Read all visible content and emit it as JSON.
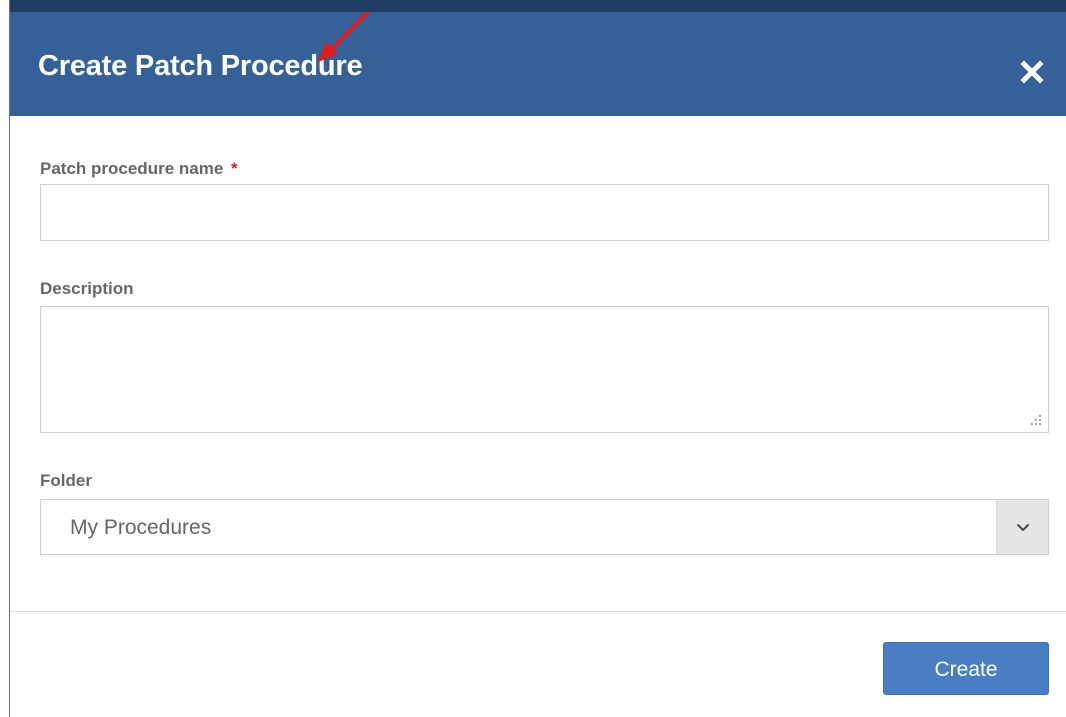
{
  "dialog": {
    "title": "Create Patch Procedure",
    "close_icon": "close-icon"
  },
  "form": {
    "name_label": "Patch procedure name",
    "required_marker": "*",
    "name_value": "",
    "description_label": "Description",
    "description_value": "",
    "folder_label": "Folder",
    "folder_selected": "My Procedures",
    "folder_arrow_icon": "chevron-down-icon"
  },
  "footer": {
    "create_label": "Create"
  },
  "colors": {
    "header": "#356198",
    "accent": "#4a7ec3",
    "required": "#c62828",
    "annotation": "#e31b1b"
  }
}
